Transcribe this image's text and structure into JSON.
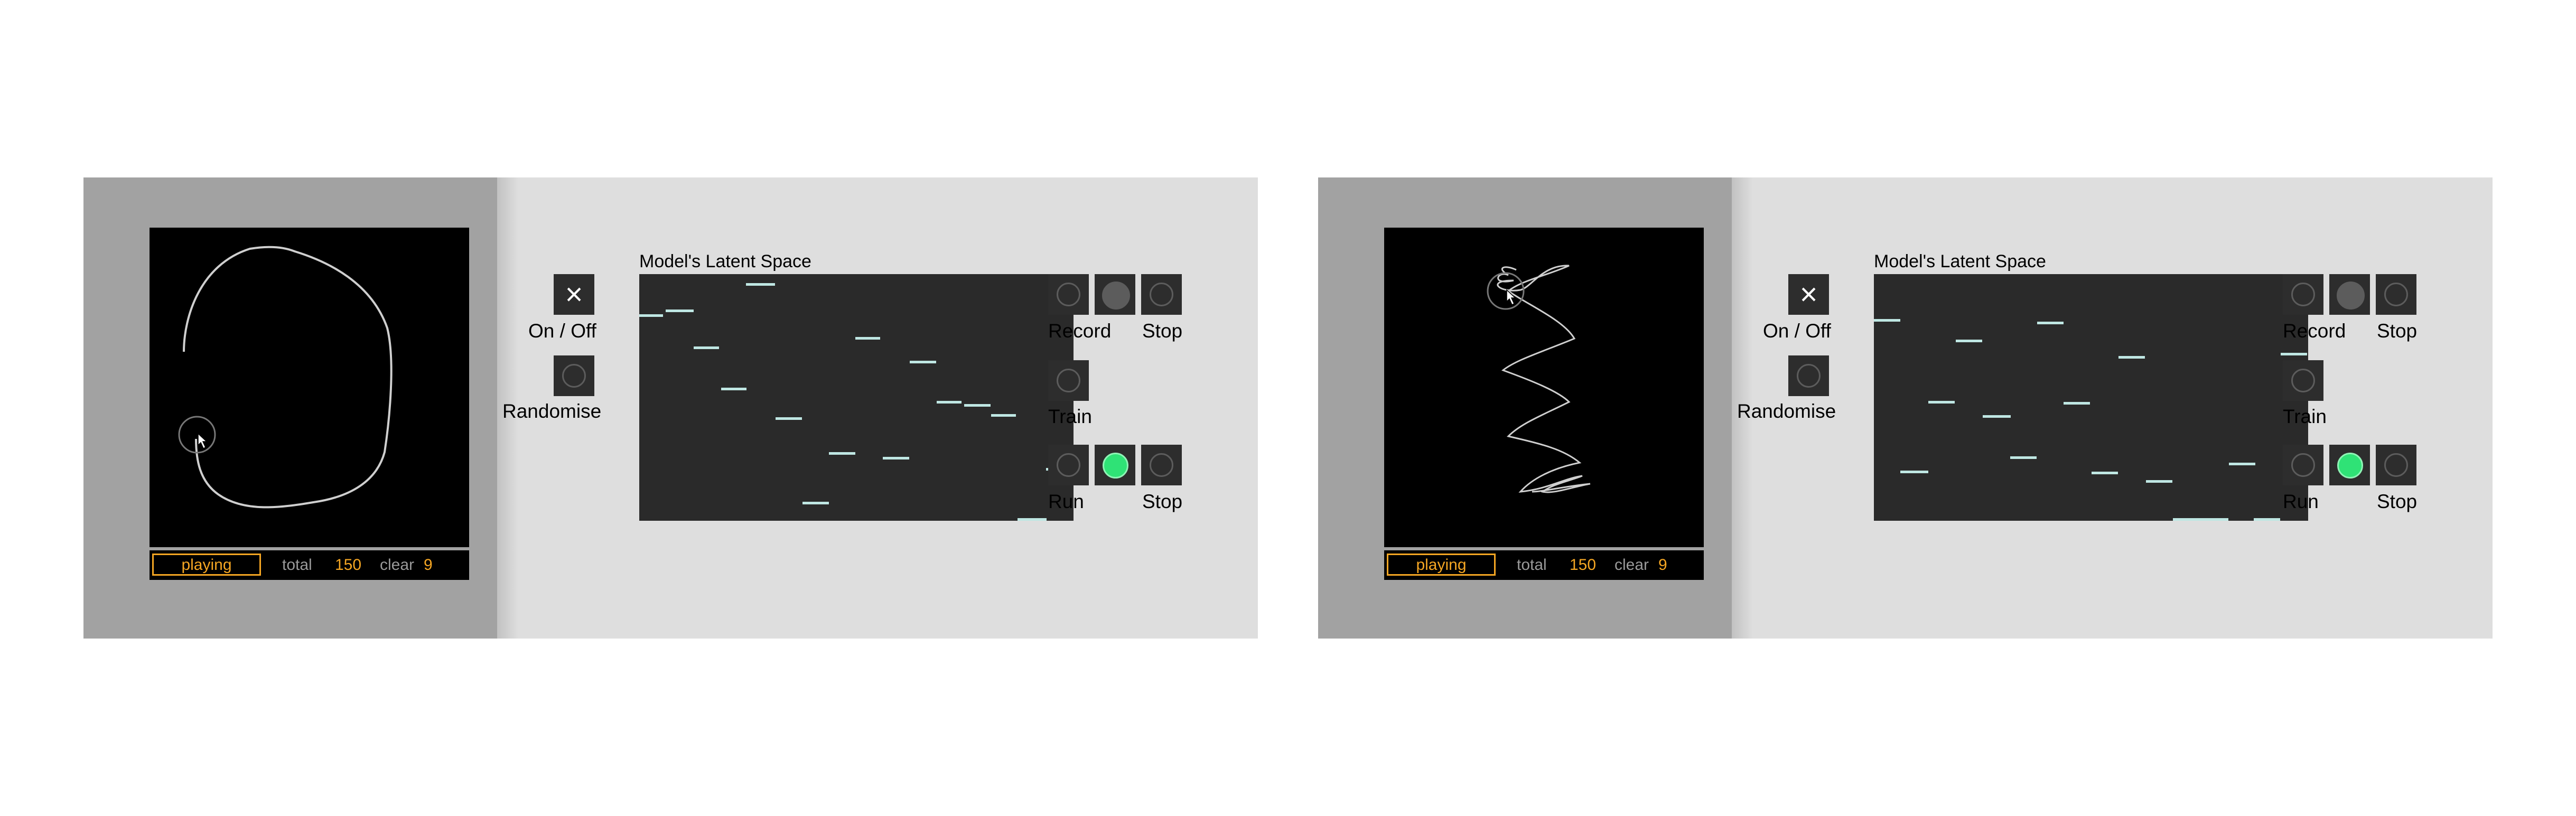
{
  "panels": [
    {
      "status": {
        "state": "playing",
        "total_label": "total",
        "total_value": "150",
        "clear_label": "clear",
        "clear_value": "9"
      },
      "latent_title": "Model's Latent Space",
      "controls": {
        "on_off": "On / Off",
        "randomise": "Randomise",
        "record": "Record",
        "stop_record": "Stop",
        "train": "Train",
        "run": "Run",
        "stop_run": "Stop"
      }
    },
    {
      "status": {
        "state": "playing",
        "total_label": "total",
        "total_value": "150",
        "clear_label": "clear",
        "clear_value": "9"
      },
      "latent_title": "Model's Latent Space",
      "controls": {
        "on_off": "On / Off",
        "randomise": "Randomise",
        "record": "Record",
        "stop_record": "Stop",
        "train": "Train",
        "run": "Run",
        "stop_run": "Stop"
      }
    }
  ],
  "colors": {
    "accent": "#f5a623",
    "run_active": "#2fe276",
    "latent_marker": "#bfe7e3"
  },
  "icons": {
    "toggle": "close-x-icon",
    "cursor": "pointer-cursor-icon"
  }
}
